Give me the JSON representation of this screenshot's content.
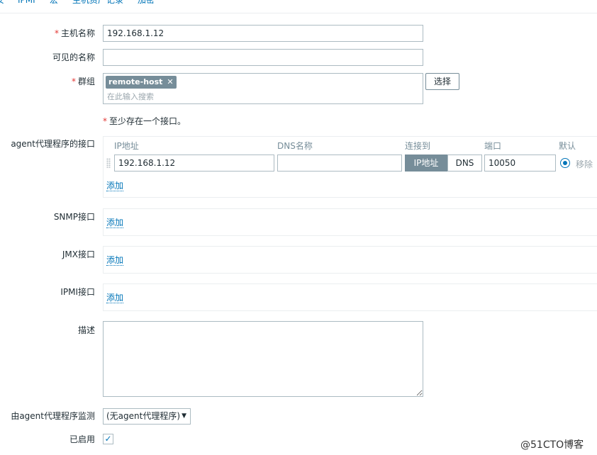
{
  "tabs": [
    "安",
    "IPMI",
    "宏",
    "主机资产记录",
    "加密"
  ],
  "form": {
    "host_name": {
      "label": "主机名称",
      "required": true,
      "value": "192.168.1.12"
    },
    "visible_name": {
      "label": "可见的名称",
      "value": ""
    },
    "groups": {
      "label": "群组",
      "required": true,
      "chip": "remote-host",
      "chip_remove": "✕",
      "placeholder": "在此输入搜索",
      "select_button": "选择"
    },
    "interface_note": "至少存在一个接口。",
    "agent": {
      "label": "agent代理程序的接口",
      "columns": [
        "IP地址",
        "DNS名称",
        "连接到",
        "端口",
        "默认"
      ],
      "row": {
        "ip": "192.168.1.12",
        "dns": "",
        "connect_ip": "IP地址",
        "connect_dns": "DNS",
        "port": "10050",
        "remove": "移除"
      },
      "add": "添加"
    },
    "snmp": {
      "label": "SNMP接口",
      "add": "添加"
    },
    "jmx": {
      "label": "JMX接口",
      "add": "添加"
    },
    "ipmi": {
      "label": "IPMI接口",
      "add": "添加"
    },
    "description": {
      "label": "描述",
      "value": ""
    },
    "monitored_by": {
      "label": "由agent代理程序监测",
      "value": "(无agent代理程序)"
    },
    "enabled": {
      "label": "已启用",
      "checked": true
    }
  },
  "watermark": "@51CTO博客",
  "colors": {
    "link": "#0275b8",
    "required": "#e33734",
    "chip_bg": "#768d99",
    "border": "#acbbc2"
  }
}
